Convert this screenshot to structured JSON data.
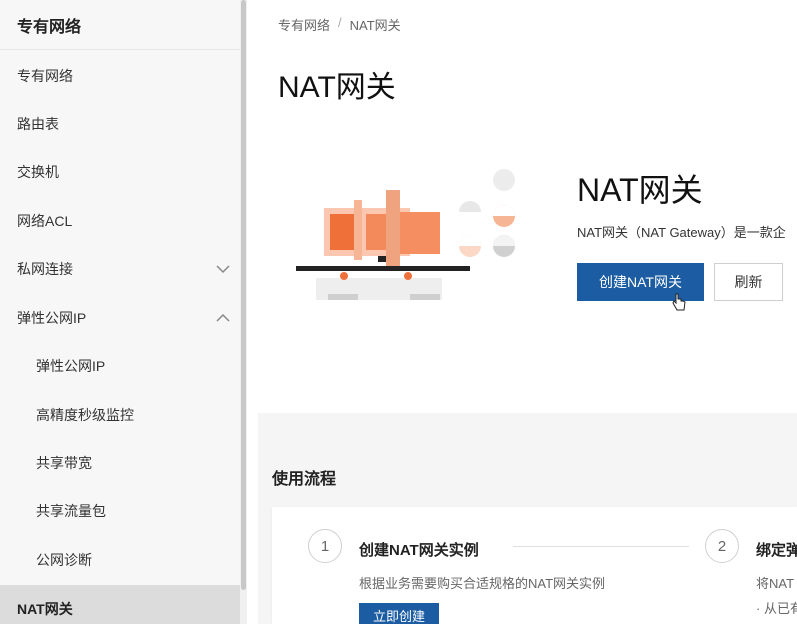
{
  "sidebar": {
    "title": "专有网络",
    "items": [
      {
        "label": "专有网络"
      },
      {
        "label": "路由表"
      },
      {
        "label": "交换机"
      },
      {
        "label": "网络ACL"
      },
      {
        "label": "私网连接"
      },
      {
        "label": "弹性公网IP"
      },
      {
        "label": "弹性公网IP"
      },
      {
        "label": "高精度秒级监控"
      },
      {
        "label": "共享带宽"
      },
      {
        "label": "共享流量包"
      },
      {
        "label": "公网诊断"
      },
      {
        "label": "NAT网关"
      }
    ]
  },
  "breadcrumb": {
    "root": "专有网络",
    "sep": "/",
    "current": "NAT网关"
  },
  "page": {
    "title": "NAT网关"
  },
  "hero": {
    "title": "NAT网关",
    "description": "NAT网关（NAT Gateway）是一款企",
    "create_button": "创建NAT网关",
    "refresh_button": "刷新"
  },
  "process": {
    "title": "使用流程",
    "steps": [
      {
        "num": "1",
        "title": "创建NAT网关实例",
        "desc": "根据业务需要购买合适规格的NAT网关实例",
        "button": "立即创建"
      },
      {
        "num": "2",
        "title": "绑定弹",
        "desc": "将NAT",
        "desc2": "· 从已有"
      }
    ]
  },
  "colors": {
    "primary": "#1b5ca3",
    "accent_orange": "#f0703a"
  }
}
